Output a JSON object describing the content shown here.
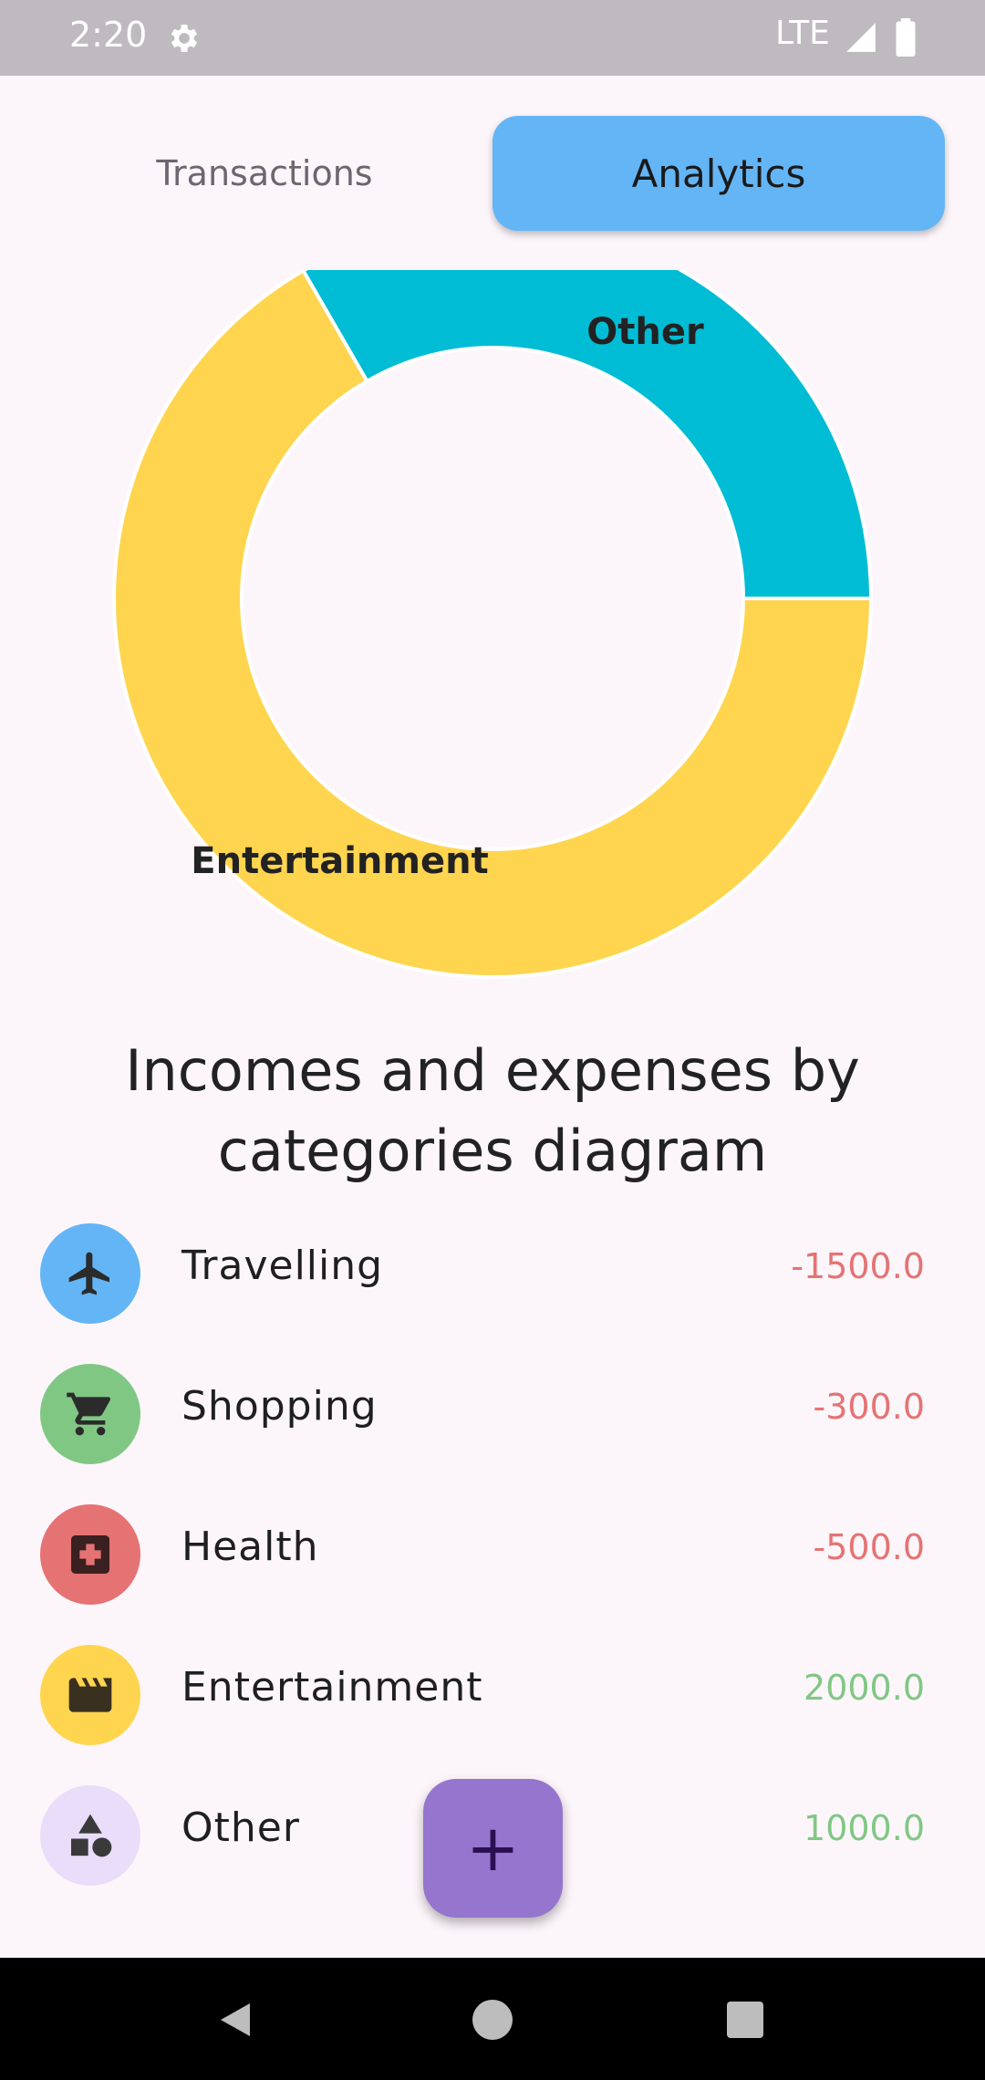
{
  "status_bar": {
    "time": "2:20",
    "network": "LTE"
  },
  "tabs": [
    {
      "label": "Transactions",
      "selected": false
    },
    {
      "label": "Analytics",
      "selected": true
    }
  ],
  "chart_data": {
    "type": "pie",
    "donut": true,
    "slices": [
      {
        "label": "Entertainment",
        "value": 2000.0,
        "color": "#FFD54F"
      },
      {
        "label": "Other",
        "value": 1000.0,
        "color": "#00BCD4"
      }
    ]
  },
  "section_title": "Incomes and expenses by categories diagram",
  "categories": [
    {
      "name": "Travelling",
      "amount": "-1500.0",
      "icon": "airplane-icon",
      "icon_bg": "#64B5F6",
      "amount_color": "#E57373"
    },
    {
      "name": "Shopping",
      "amount": "-300.0",
      "icon": "cart-icon",
      "icon_bg": "#81C784",
      "amount_color": "#E57373"
    },
    {
      "name": "Health",
      "amount": "-500.0",
      "icon": "medical-icon",
      "icon_bg": "#E57373",
      "amount_color": "#E57373"
    },
    {
      "name": "Entertainment",
      "amount": "2000.0",
      "icon": "movie-icon",
      "icon_bg": "#FFD54F",
      "amount_color": "#81C784"
    },
    {
      "name": "Other",
      "amount": "1000.0",
      "icon": "shapes-icon",
      "icon_bg": "#E9DDF9",
      "amount_color": "#81C784"
    }
  ],
  "fab": {
    "symbol": "+"
  }
}
